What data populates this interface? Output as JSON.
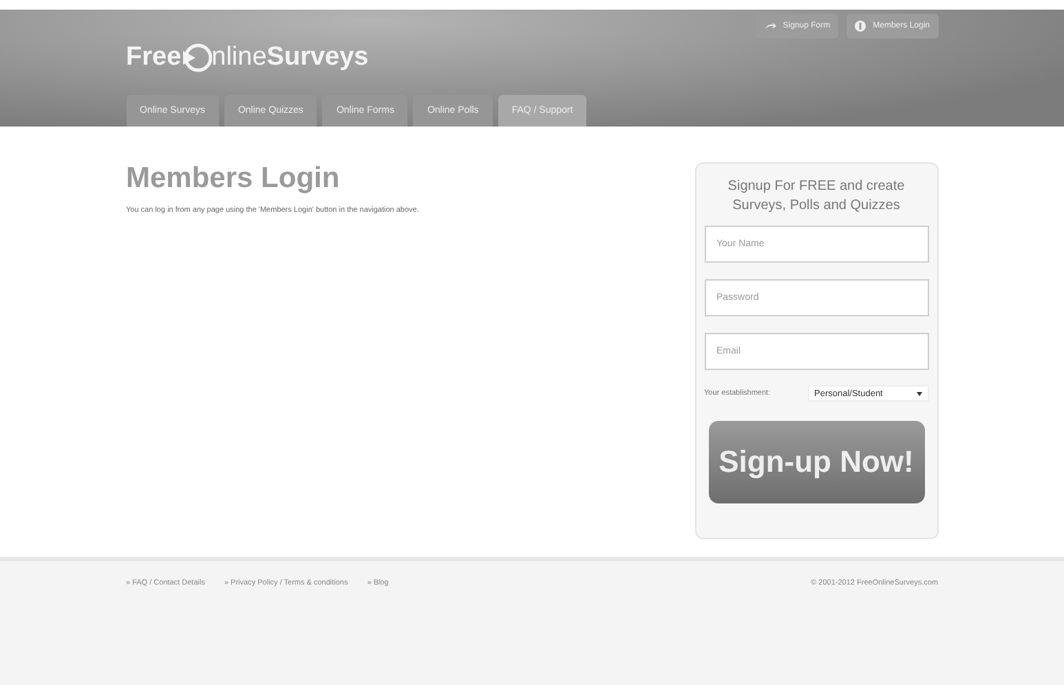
{
  "header": {
    "logo": {
      "before": "Free",
      "after": "nline**Surveys**"
    },
    "buttons": [
      {
        "kind": "signup",
        "label": "Signup Form"
      },
      {
        "kind": "login",
        "label": "Members Login"
      }
    ],
    "tabs": [
      {
        "label": "Online Surveys",
        "selected": false
      },
      {
        "label": "Online Quizzes",
        "selected": false
      },
      {
        "label": "Online Forms",
        "selected": false
      },
      {
        "label": "Online Polls",
        "selected": false
      },
      {
        "label": "FAQ / Support",
        "selected": true
      }
    ]
  },
  "main": {
    "title": "Members Login",
    "text": "You can log in from any page using the 'Members Login' button in the navigation above."
  },
  "signup": {
    "heading": "Signup For FREE and create Surveys, Polls and Quizzes",
    "fields": [
      {
        "placeholder": "Your Name"
      },
      {
        "placeholder": "Password"
      },
      {
        "placeholder": "Email"
      }
    ],
    "establishment": {
      "label": "Your establishment:",
      "value": "Personal/Student"
    },
    "button": "Sign-up Now!"
  },
  "footer": {
    "links": [
      "» FAQ / Contact Details",
      "» Privacy Policy / Terms & conditions",
      "» Blog"
    ],
    "copyright": "© 2001-2012 FreeOnlineSurveys.com"
  }
}
